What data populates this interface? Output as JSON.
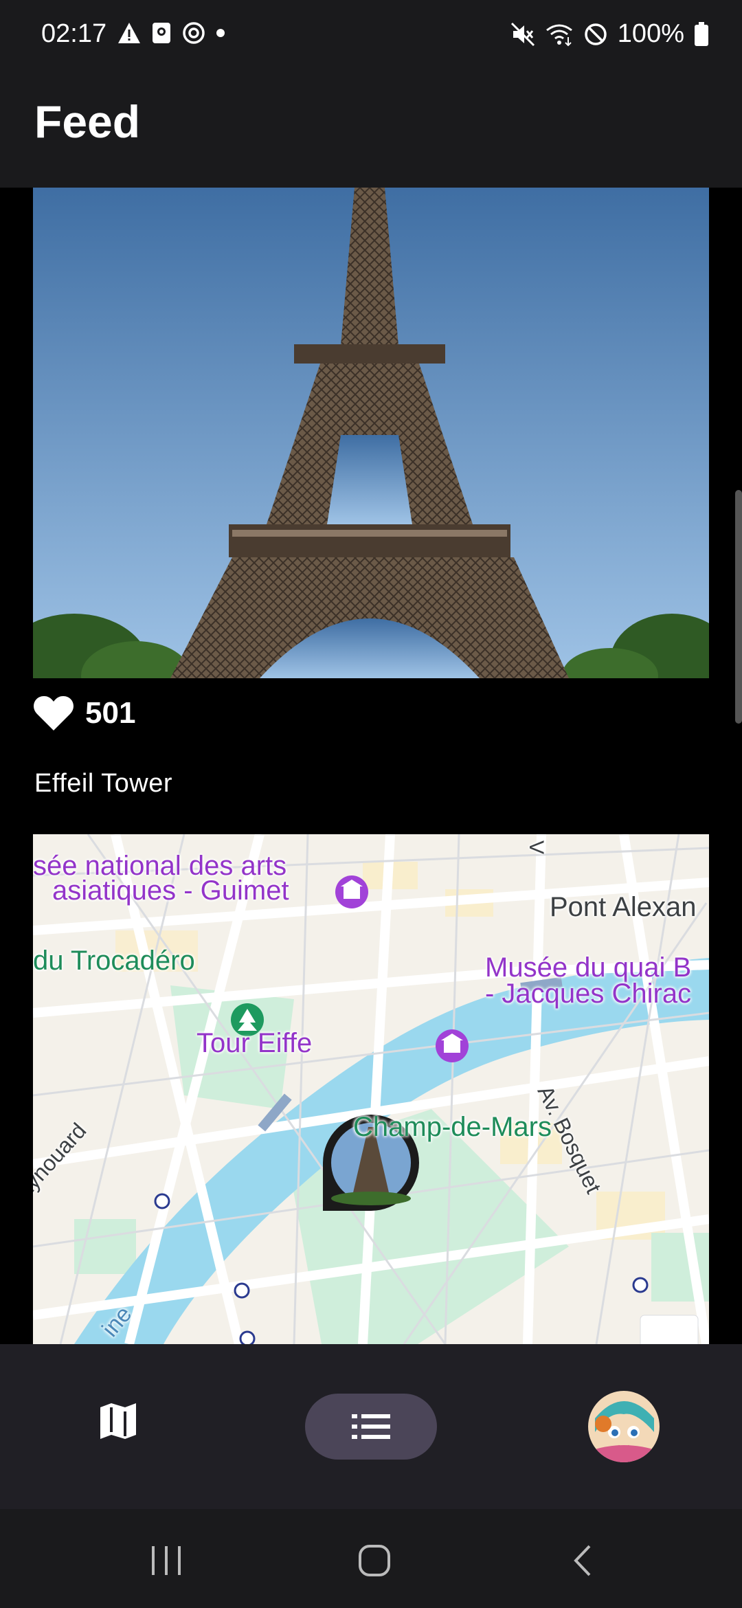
{
  "status_bar": {
    "time": "02:17",
    "battery": "100%",
    "left_icons": [
      "warning-icon",
      "notification-icon",
      "sync-icon",
      "dot-icon"
    ],
    "right_icons": [
      "mute-icon",
      "wifi-icon",
      "no-disturb-icon",
      "battery-icon"
    ]
  },
  "app_bar": {
    "title": "Feed"
  },
  "post": {
    "likes": "501",
    "caption": "Effeil Tower",
    "map": {
      "labels": {
        "museum_guimet_1": "sée national des arts",
        "museum_guimet_2": "asiatiques - Guimet",
        "trocadero": "du Trocadéro",
        "quai_branly_1": "Musée du quai B",
        "quai_branly_2": "- Jacques Chirac",
        "pont": "Pont Alexan",
        "tour": "Tour Eiffe",
        "bosquet": "Av. Bosquet",
        "champ": "Champ-de-Mars",
        "raynouard": "aynouard",
        "v_label": "V",
        "seine": "ine"
      }
    }
  },
  "bottom_nav": {
    "items": [
      {
        "name": "map",
        "icon": "map-icon"
      },
      {
        "name": "feed",
        "icon": "list-icon",
        "selected": true
      },
      {
        "name": "profile",
        "icon": "avatar"
      }
    ]
  },
  "colors": {
    "surface": "#1a1a1c",
    "nav_bg": "#201f25",
    "selected_pill": "#4b4558",
    "museum_poi": "#9334c9",
    "park_poi": "#1e8c5a",
    "water": "#9ad8ee"
  }
}
